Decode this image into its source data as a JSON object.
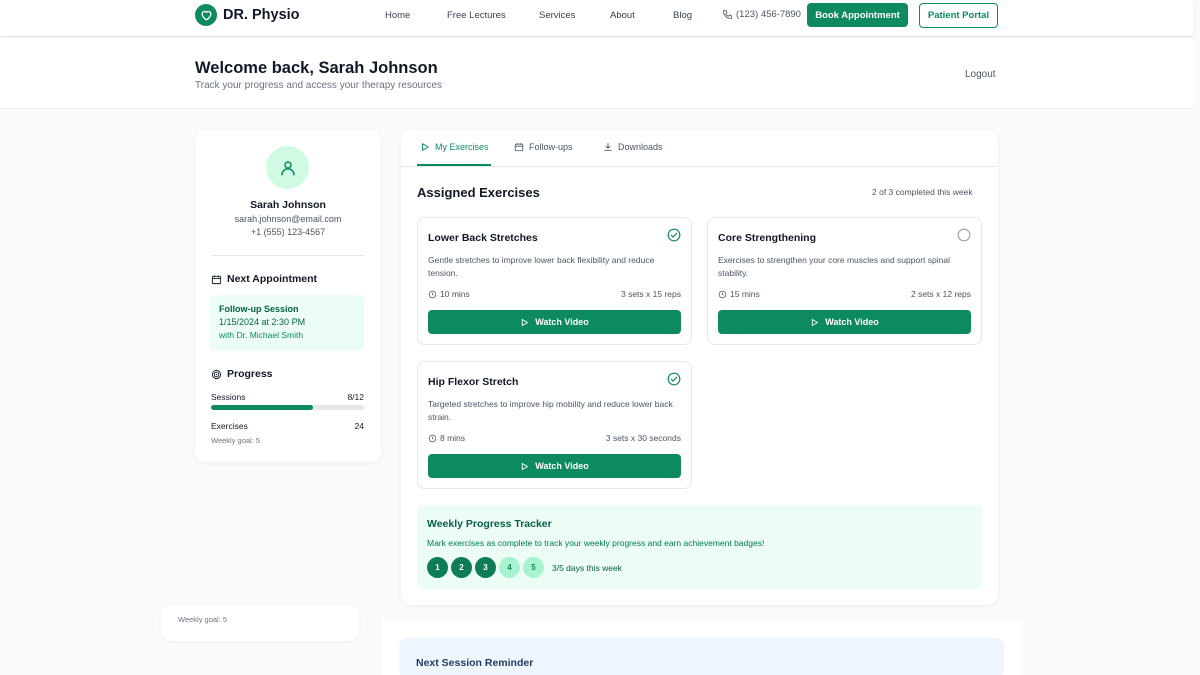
{
  "colors": {
    "brand": "#0e8a5f",
    "brand_light": "#ecfdf5",
    "reminder_bg": "#eff6ff"
  },
  "nav": {
    "logo_icon": "heart-icon",
    "logo_text": "DR. Physio",
    "links": [
      "Home",
      "Free Lectures",
      "Services",
      "About",
      "Blog"
    ],
    "phone_icon": "phone-icon",
    "phone": "(123) 456-7890",
    "book_label": "Book Appointment",
    "portal_label": "Patient Portal"
  },
  "header": {
    "title": "Welcome back, Sarah Johnson",
    "subtitle": "Track your progress and access your therapy resources",
    "logout_label": "Logout"
  },
  "sidebar": {
    "avatar_icon": "user-icon",
    "name": "Sarah Johnson",
    "email": "sarah.johnson@email.com",
    "phone": "+1 (555) 123-4567",
    "appointment": {
      "heading": "Next Appointment",
      "heading_icon": "calendar-icon",
      "type": "Follow-up Session",
      "datetime": "1/15/2024 at 2:30 PM",
      "doctor": "with Dr. Michael Smith"
    },
    "progress": {
      "heading": "Progress",
      "heading_icon": "target-icon",
      "sessions_label": "Sessions",
      "sessions_value": "8/12",
      "sessions_fraction": 0.667,
      "exercises_label": "Exercises",
      "exercises_value": "24",
      "weekly_goal": "Weekly goal: 5"
    }
  },
  "tabs": [
    {
      "label": "My Exercises",
      "icon": "play-icon",
      "active": true
    },
    {
      "label": "Follow-ups",
      "icon": "calendar-icon",
      "active": false
    },
    {
      "label": "Downloads",
      "icon": "download-icon",
      "active": false
    }
  ],
  "exercises": {
    "title": "Assigned Exercises",
    "completion": "2 of 3 completed this week",
    "items": [
      {
        "title": "Lower Back Stretches",
        "description": "Gentle stretches to improve lower back flexibility and reduce tension.",
        "duration": "10 mins",
        "sets": "3 sets x 15 reps",
        "completed": true,
        "button": "Watch Video"
      },
      {
        "title": "Core Strengthening",
        "description": "Exercises to strengthen your core muscles and support spinal stability.",
        "duration": "15 mins",
        "sets": "2 sets x 12 reps",
        "completed": false,
        "button": "Watch Video"
      },
      {
        "title": "Hip Flexor Stretch",
        "description": "Targeted stretches to improve hip mobility and reduce lower back strain.",
        "duration": "8 mins",
        "sets": "3 sets x 30 seconds",
        "completed": true,
        "button": "Watch Video"
      }
    ]
  },
  "tracker": {
    "title": "Weekly Progress Tracker",
    "subtitle": "Mark exercises as complete to track your weekly progress and earn achievement badges!",
    "days": [
      "1",
      "2",
      "3",
      "4",
      "5"
    ],
    "days_completed": 3,
    "summary": "3/5 days this week"
  },
  "below": {
    "weekly_goal": "Weekly goal: 5",
    "reminder_title": "Next Session Reminder"
  }
}
